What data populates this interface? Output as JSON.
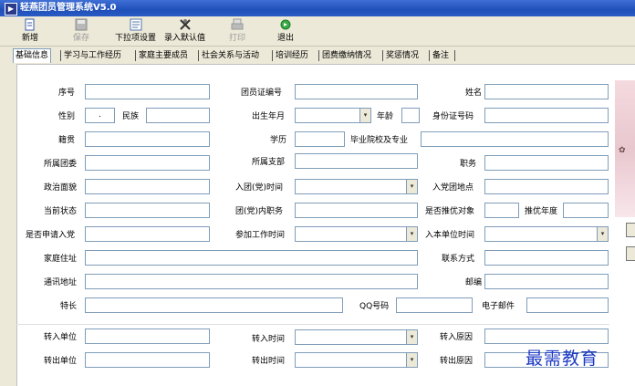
{
  "window": {
    "title": "轻燕团员管理系统V5.0"
  },
  "toolbar": {
    "new": "新增",
    "save": "保存",
    "dropdown_settings": "下拉项设置",
    "enter_default": "录入默认值",
    "print": "打印",
    "exit": "退出"
  },
  "tabs": [
    "基础信息",
    "学习与工作经历",
    "家庭主要成员",
    "社会关系与活动",
    "培训经历",
    "团费缴纳情况",
    "奖惩情况",
    "备注"
  ],
  "form": {
    "seq_no": "序号",
    "member_cert_no": "团员证编号",
    "name": "姓名",
    "gender": "性别",
    "gender_value": ".",
    "ethnicity": "民族",
    "birth_month": "出生年月",
    "age": "年龄",
    "id_number": "身份证号码",
    "native_place": "籍贯",
    "education": "学历",
    "school_major": "毕业院校及专业",
    "league_committee": "所属团委",
    "league_branch": "所属支部",
    "position": "职务",
    "political_status": "政治面貌",
    "join_time": "入团(党)时间",
    "join_place": "入党团地点",
    "current_status": "当前状态",
    "internal_position": "团(党)内职务",
    "excellence_target": "是否推优对象",
    "excellence_year": "推优年度",
    "applied_party": "是否申请入党",
    "work_start_time": "参加工作时间",
    "unit_entry_time": "入本单位时间",
    "home_address": "家庭住址",
    "contact": "联系方式",
    "mail_address": "通讯地址",
    "postcode": "邮编",
    "specialty": "特长",
    "qq": "QQ号码",
    "email": "电子邮件",
    "transfer_in_unit": "转入单位",
    "transfer_in_time": "转入时间",
    "transfer_in_reason": "转入原因",
    "transfer_out_unit": "转出单位",
    "transfer_out_time": "转出时间",
    "transfer_out_reason": "转出原因"
  },
  "watermark": "最需教育"
}
